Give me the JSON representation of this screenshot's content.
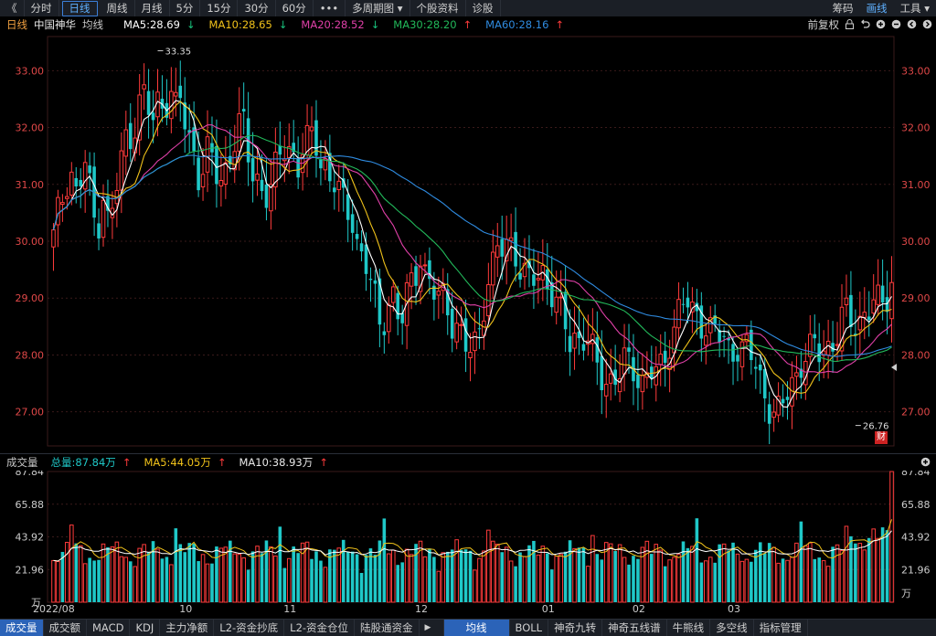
{
  "toolbar": {
    "back": "《",
    "tabs": [
      "分时",
      "日线",
      "周线",
      "月线",
      "5分",
      "15分",
      "30分",
      "60分",
      "•••",
      "多周期图 ▾",
      "个股资料",
      "诊股"
    ],
    "active_index": 1,
    "right_tabs": [
      "筹码",
      "画线",
      "工具 ▾"
    ],
    "right_active_index": 1
  },
  "legend": {
    "period": "日线",
    "stock_name": "中国神华",
    "avg_label": "均线",
    "right_label": "前复权",
    "mas": [
      {
        "text": "MA5:28.69",
        "arrow": "↓",
        "color": "#ffffff",
        "arrow_color": "#19c37d"
      },
      {
        "text": "MA10:28.65",
        "arrow": "↓",
        "color": "#f0c21a",
        "arrow_color": "#19c37d"
      },
      {
        "text": "MA20:28.52",
        "arrow": "↓",
        "color": "#e040a8",
        "arrow_color": "#19c37d"
      },
      {
        "text": "MA30:28.20",
        "arrow": "↑",
        "color": "#22b85a",
        "arrow_color": "#ff3b3b"
      },
      {
        "text": "MA60:28.16",
        "arrow": "↑",
        "color": "#2f8be0",
        "arrow_color": "#ff3b3b"
      }
    ]
  },
  "volume_legend": {
    "title": "成交量",
    "total": "总量:87.84万",
    "total_arrow": "↑",
    "ma5": "MA5:44.05万",
    "ma5_arrow": "↑",
    "ma10": "MA10:38.93万",
    "ma10_arrow": "↑"
  },
  "bottom_tabs": {
    "left": [
      "成交量",
      "成交额",
      "MACD",
      "KDJ",
      "主力净额",
      "L2-资金抄底",
      "L2-资金仓位",
      "陆股通资金"
    ],
    "left_active_index": 0,
    "right": [
      "均线",
      "BOLL",
      "神奇九转",
      "神奇五线谱",
      "牛熊线",
      "多空线",
      "指标管理"
    ],
    "right_active_index": 0
  },
  "fin_badge": "财",
  "colors": {
    "up": "#ff3b3b",
    "down": "#1fc8c8",
    "grid": "#3a1a1a",
    "price_label": "#e04848"
  },
  "chart_data": [
    {
      "type": "candlestick",
      "title": "中国神华 日线",
      "price_ticks": [
        "33.00",
        "32.00",
        "31.00",
        "30.00",
        "29.00",
        "28.00",
        "27.00"
      ],
      "ylim": [
        26.4,
        33.6
      ],
      "x_tick_labels": [
        "2022/08",
        "10",
        "11",
        "12",
        "01",
        "02",
        "03"
      ],
      "annotations": [
        {
          "text": "33.35",
          "value": 33.35,
          "index": 23
        },
        {
          "text": "26.76",
          "value": 26.76,
          "index": 178
        }
      ],
      "ohlc_seed": [
        30.05,
        30.55,
        30.9,
        31.4,
        30.8,
        31.05,
        31.5,
        30.4,
        30.3,
        30.9,
        30.2,
        30.7,
        31.3,
        31.8,
        31.9,
        32.2,
        32.65,
        32.3,
        32.1,
        32.55,
        32.4,
        32.7,
        32.3,
        32.5,
        31.85,
        31.75,
        31.2,
        31.3,
        31.6,
        31.2,
        31.05,
        31.3,
        31.6,
        31.9,
        32.15,
        31.5,
        31.2,
        31.1,
        30.8,
        30.85,
        31.2,
        31.55,
        31.8,
        31.6,
        31.25,
        31.6,
        31.75,
        31.9,
        31.5,
        31.35,
        31.0,
        30.95,
        30.7,
        30.55,
        30.45,
        29.8,
        29.6,
        29.3,
        28.95,
        28.45,
        28.9,
        29.1,
        28.6,
        28.6,
        29.3,
        29.4,
        29.85,
        29.35,
        29.1,
        29.0,
        29.15,
        28.9,
        28.55,
        28.4,
        28.05,
        28.1,
        28.3,
        28.6,
        29.2,
        29.4,
        29.8,
        29.9,
        30.1,
        29.9,
        29.5,
        29.3,
        29.25,
        29.45,
        29.55,
        29.25,
        29.0,
        28.75,
        28.55,
        28.3,
        28.4,
        28.2,
        28.3,
        28.05,
        27.75,
        27.65,
        27.6,
        27.5,
        27.65,
        27.9,
        27.8,
        27.75,
        27.55,
        27.6,
        27.7,
        27.65,
        27.9,
        28.3,
        28.55,
        28.9,
        28.9,
        28.7,
        28.75,
        28.6,
        28.4,
        28.45,
        28.3,
        28.2,
        28.1,
        28.2,
        28.05,
        28.1,
        27.9,
        27.7,
        27.4,
        27.1,
        26.9,
        26.95,
        27.3,
        27.55,
        27.7,
        27.95,
        28.0,
        28.1,
        28.05,
        28.2,
        28.15,
        28.3,
        28.6,
        28.7,
        28.55,
        28.6,
        28.75,
        28.8,
        28.9,
        28.85,
        29.0,
        29.35
      ]
    },
    {
      "type": "bar",
      "title": "成交量",
      "unit": "万",
      "tick_labels": [
        "87.84",
        "65.88",
        "43.92",
        "21.96"
      ],
      "ylim": [
        0,
        87.84
      ],
      "last_value": 87.84
    }
  ]
}
